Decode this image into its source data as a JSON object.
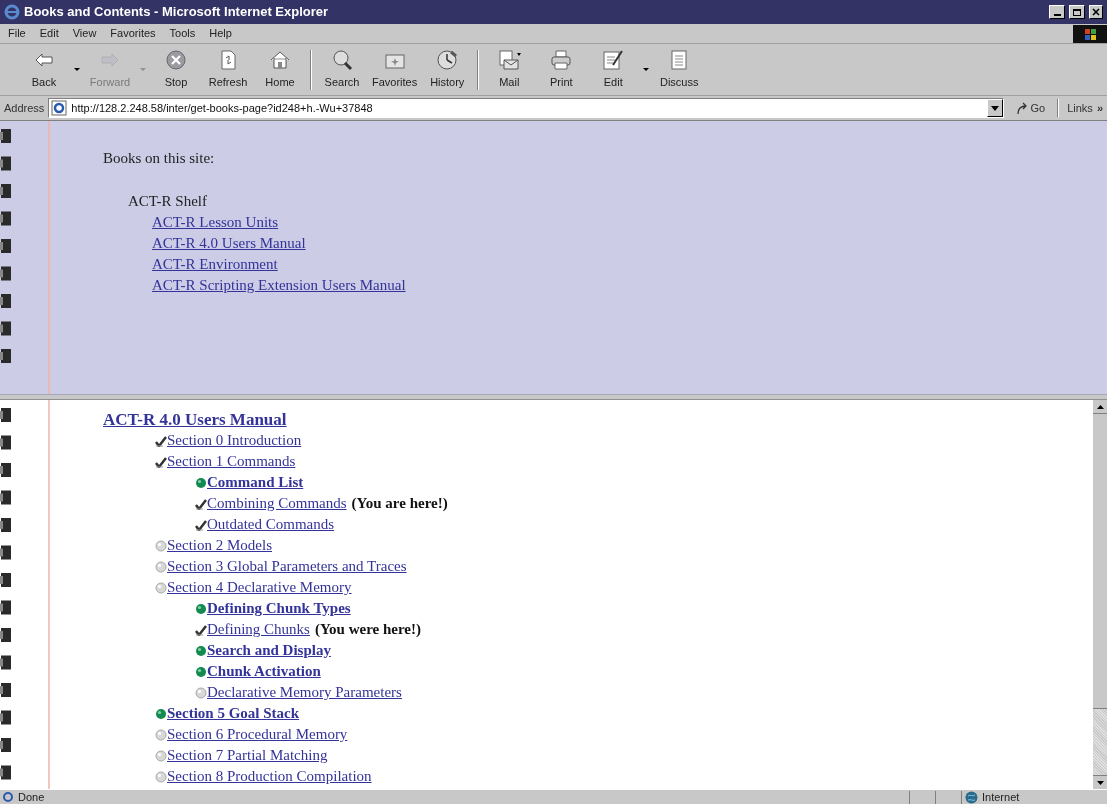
{
  "window": {
    "title": "Books and Contents - Microsoft Internet Explorer"
  },
  "menu": [
    "File",
    "Edit",
    "View",
    "Favorites",
    "Tools",
    "Help"
  ],
  "toolbar": [
    {
      "kind": "back",
      "label": "Back",
      "disabled": false,
      "dropdown": true
    },
    {
      "kind": "forward",
      "label": "Forward",
      "disabled": true,
      "dropdown": true
    },
    {
      "kind": "stop",
      "label": "Stop",
      "disabled": false,
      "dropdown": false
    },
    {
      "kind": "refresh",
      "label": "Refresh",
      "disabled": false,
      "dropdown": false
    },
    {
      "kind": "home",
      "label": "Home",
      "disabled": false,
      "dropdown": false,
      "separator_after": true
    },
    {
      "kind": "search",
      "label": "Search",
      "disabled": false,
      "dropdown": false
    },
    {
      "kind": "favorites",
      "label": "Favorites",
      "disabled": false,
      "dropdown": false
    },
    {
      "kind": "history",
      "label": "History",
      "disabled": false,
      "dropdown": false,
      "separator_after": true
    },
    {
      "kind": "mail",
      "label": "Mail",
      "disabled": false,
      "dropdown": false
    },
    {
      "kind": "print",
      "label": "Print",
      "disabled": false,
      "dropdown": false
    },
    {
      "kind": "edit",
      "label": "Edit",
      "disabled": false,
      "dropdown": true
    },
    {
      "kind": "discuss",
      "label": "Discuss",
      "disabled": false,
      "dropdown": false
    }
  ],
  "address": {
    "label": "Address",
    "value": "http://128.2.248.58/inter/get-books-page?id248+h.-Wu+37848",
    "go": "Go",
    "links": "Links",
    "more": "»"
  },
  "shelf": {
    "heading": "Books on this site:",
    "name": "ACT-R Shelf",
    "books": [
      "ACT-R Lesson Units",
      "ACT-R 4.0 Users Manual",
      "ACT-R Environment",
      "ACT-R Scripting Extension Users Manual"
    ]
  },
  "contents": {
    "title": "ACT-R 4.0 Users Manual",
    "items": [
      {
        "label": "Section 0 Introduction",
        "kind": "check"
      },
      {
        "label": "Section 1 Commands",
        "kind": "check",
        "children": [
          {
            "label": "Command List",
            "kind": "green"
          },
          {
            "label": "Combining Commands",
            "kind": "check",
            "note": "(You are here!)"
          },
          {
            "label": "Outdated Commands",
            "kind": "check"
          }
        ]
      },
      {
        "label": "Section 2 Models",
        "kind": "gray"
      },
      {
        "label": "Section 3 Global Parameters and Traces",
        "kind": "gray"
      },
      {
        "label": "Section 4 Declarative Memory",
        "kind": "gray",
        "children": [
          {
            "label": "Defining Chunk Types",
            "kind": "green"
          },
          {
            "label": "Defining Chunks",
            "kind": "check",
            "note": "(You were here!)"
          },
          {
            "label": "Search and Display",
            "kind": "green"
          },
          {
            "label": "Chunk Activation",
            "kind": "green"
          },
          {
            "label": "Declarative Memory Parameters",
            "kind": "gray"
          }
        ]
      },
      {
        "label": "Section 5 Goal Stack",
        "kind": "green"
      },
      {
        "label": "Section 6 Procedural Memory",
        "kind": "gray"
      },
      {
        "label": "Section 7 Partial Matching",
        "kind": "gray"
      },
      {
        "label": "Section 8 Production Compilation",
        "kind": "gray"
      }
    ]
  },
  "status_bar": {
    "text": "Done",
    "zone": "Internet"
  }
}
